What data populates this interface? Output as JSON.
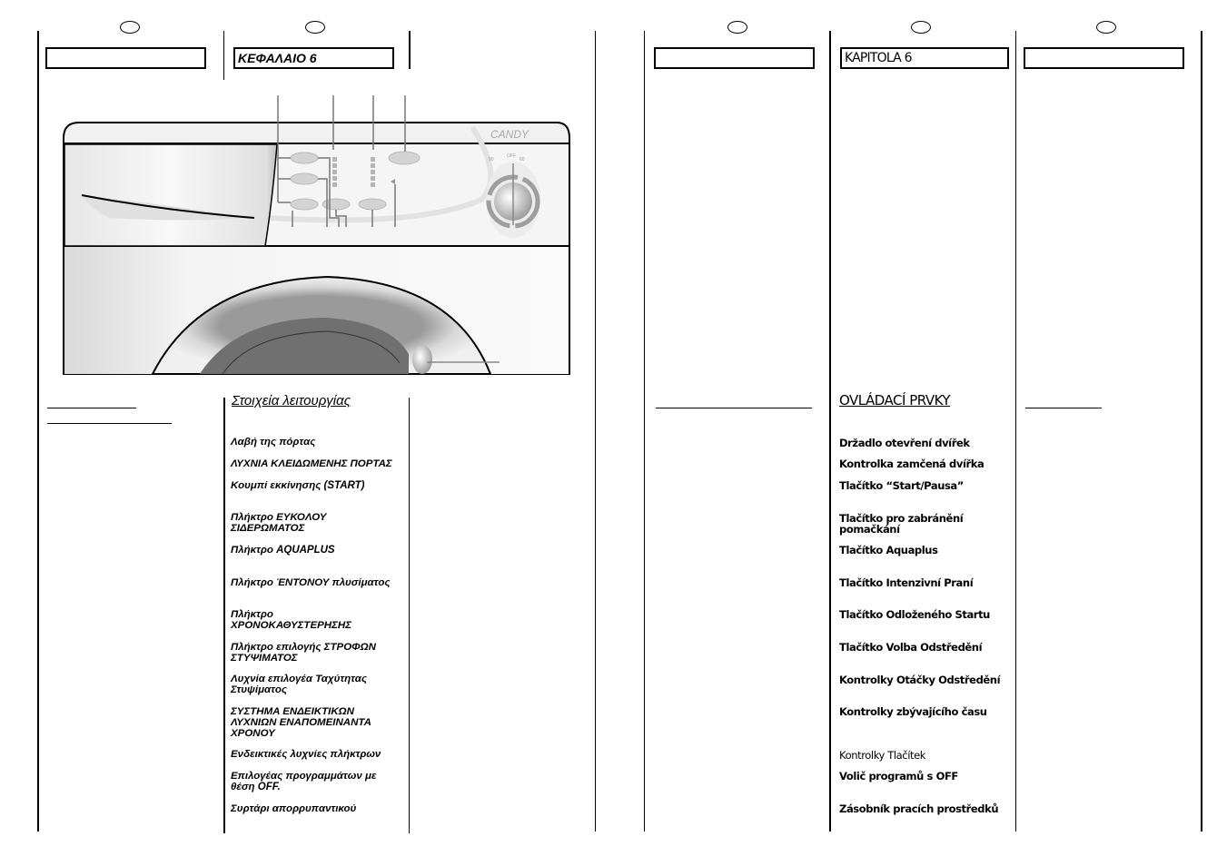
{
  "left_page": {
    "columns": [
      {
        "header_box": "",
        "section_title": "",
        "items": []
      },
      {
        "header_box": "ΚΕΦΑΛΑΙΟ 6",
        "section_title": "Στοιχεία λειτουργίας",
        "items": [
          "Λαβή της πόρτας",
          "ΛΥΧΝΙΑ ΚΛΕΙΔΩΜΕΝΗΣ ΠΟΡΤΑΣ",
          "Κουμπί εκκίνησης (START)",
          "Πλήκτρο ΕΥΚΟΛΟΥ ΣΙΔΕΡΩΜΑΤΟΣ",
          "Πλήκτρο AQUAPLUS",
          "Πλήκτρο ΈΝΤΟΝΟΥ πλυσίματος",
          "Πλήκτρο ΧΡΟΝΟΚΑΘΥΣΤΕΡΗΣΗΣ",
          "Πλήκτρο επιλογής ΣΤΡΟΦΩΝ ΣΤΥΨΙΜΑΤΟΣ",
          "Λυχνία επιλογέα Ταχύτητας Στυψίματος",
          "ΣΥΣΤΗΜΑ ΕΝΔΕΙΚΤΙΚΩΝ ΛΥΧΝΙΩΝ ΕΝΑΠΟΜΕΙΝΑΝΤΑ ΧΡΟΝΟΥ",
          "Ενδεικτικές λυχνίες πλήκτρων",
          "Επιλογέας προγραμμάτων με θέση OFF.",
          "Συρτάρι απορρυπαντικού"
        ]
      }
    ]
  },
  "right_page": {
    "columns": [
      {
        "header_box": "",
        "section_title": "",
        "items": []
      },
      {
        "header_box": "KAPITOLA 6",
        "section_title": "OVLÁDACÍ PRVKY",
        "items": [
          "Držadlo otevření dvířek",
          "Kontrolka zamčená dvířka",
          "Tlačítko “Start/Pausa”",
          "Tlačítko pro zabránění pomačkání",
          "Tlačítko Aquaplus",
          "Tlačítko Intenzivní Praní",
          "Tlačítko Odloženého Startu",
          "Tlačítko Volba Odstředění",
          "Kontrolky Otáčky Odstředění",
          "Kontrolky zbývajícího času",
          "Kontrolky Tlačítek",
          "Volič programů s OFF",
          "Zásobník pracích prostředků"
        ]
      },
      {
        "header_box": "",
        "section_title": "",
        "items": []
      }
    ]
  },
  "illustration": {
    "brand_logo": "CANDY",
    "dial_labels": [
      "90",
      "OFF",
      "60"
    ],
    "subject": "washing-machine-control-panel"
  }
}
